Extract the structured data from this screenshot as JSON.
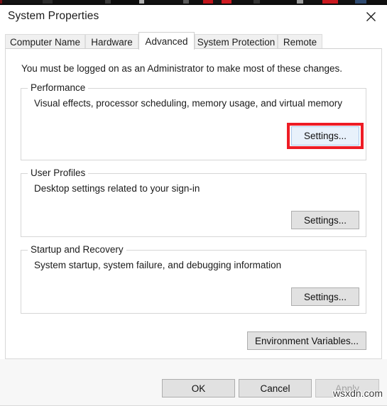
{
  "window": {
    "title": "System Properties",
    "close_icon": "close-icon"
  },
  "tabs": [
    {
      "label": "Computer Name",
      "selected": false
    },
    {
      "label": "Hardware",
      "selected": false
    },
    {
      "label": "Advanced",
      "selected": true
    },
    {
      "label": "System Protection",
      "selected": false
    },
    {
      "label": "Remote",
      "selected": false
    }
  ],
  "body": {
    "intro": "You must be logged on as an Administrator to make most of these changes."
  },
  "groups": [
    {
      "legend": "Performance",
      "description": "Visual effects, processor scheduling, memory usage, and virtual memory",
      "button": "Settings...",
      "highlighted": true
    },
    {
      "legend": "User Profiles",
      "description": "Desktop settings related to your sign-in",
      "button": "Settings...",
      "highlighted": false
    },
    {
      "legend": "Startup and Recovery",
      "description": "System startup, system failure, and debugging information",
      "button": "Settings...",
      "highlighted": false
    }
  ],
  "environment_button": "Environment Variables...",
  "footer": {
    "ok": "OK",
    "cancel": "Cancel",
    "apply": "Apply",
    "apply_disabled": true
  },
  "watermark": "wsxdn.com",
  "colors": {
    "highlight_red": "#ee1c25",
    "button_face": "#e1e1e1",
    "button_border": "#adadad",
    "focus_fill": "#e8f1fb",
    "disabled_text": "#a3a3a3",
    "window_bg": "#ffffff",
    "footer_bg": "#f7f7f7"
  }
}
